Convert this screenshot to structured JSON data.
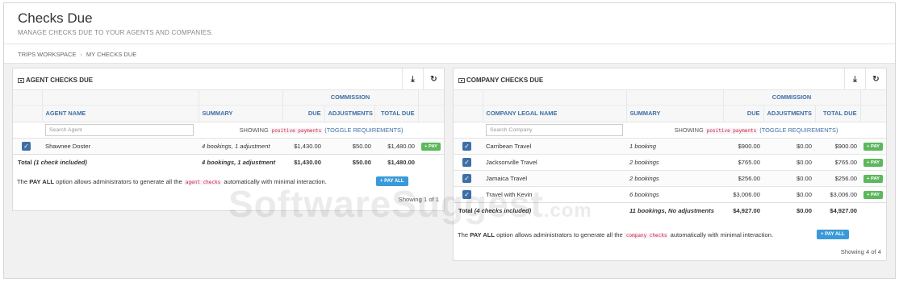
{
  "page": {
    "title": "Checks Due",
    "subtitle": "MANAGE CHECKS DUE TO YOUR AGENTS AND COMPANIES."
  },
  "breadcrumb": [
    "TRIPS WORKSPACE",
    "MY CHECKS DUE"
  ],
  "agent_panel": {
    "title": "AGENT CHECKS DUE",
    "group_header": "COMMISSION",
    "columns": [
      "AGENT NAME",
      "SUMMARY",
      "DUE",
      "ADJUSTMENTS",
      "TOTAL DUE"
    ],
    "search_placeholder": "Search Agent",
    "showing_prefix": "SHOWING",
    "showing_code": "positive payments",
    "showing_toggle": "(TOGGLE REQUIREMENTS)",
    "rows": [
      {
        "name": "Shawnee Doster",
        "summary": "4 bookings, 1 adjustment",
        "due": "$1,430.00",
        "adjustments": "$50.00",
        "total": "$1,480.00",
        "pay": "+ PAY"
      }
    ],
    "total": {
      "label": "Total",
      "label_detail": "(1 check included)",
      "summary": "4 bookings, 1 adjustment",
      "due": "$1,430.00",
      "adjustments": "$50.00",
      "total": "$1,480.00"
    },
    "note_pre": "The",
    "note_bold": "PAY ALL",
    "note_mid": "option allows administrators to generate all the",
    "note_code": "agent checks",
    "note_post": "automatically with minimal interaction.",
    "pay_all": "+ PAY ALL",
    "showing_count": "Showing 1 of 1"
  },
  "company_panel": {
    "title": "COMPANY CHECKS DUE",
    "group_header": "COMMISSION",
    "columns": [
      "COMPANY LEGAL NAME",
      "SUMMARY",
      "DUE",
      "ADJUSTMENTS",
      "TOTAL DUE"
    ],
    "search_placeholder": "Search Company",
    "showing_prefix": "SHOWING",
    "showing_code": "positive payments",
    "showing_toggle": "(TOGGLE REQUIREMENTS)",
    "rows": [
      {
        "name": "Carribean Travel",
        "summary": "1 booking",
        "due": "$900.00",
        "adjustments": "$0.00",
        "total": "$900.00",
        "pay": "+ PAY"
      },
      {
        "name": "Jacksonville Travel",
        "summary": "2 bookings",
        "due": "$765.00",
        "adjustments": "$0.00",
        "total": "$765.00",
        "pay": "+ PAY"
      },
      {
        "name": "Jamaica Travel",
        "summary": "2 bookings",
        "due": "$256.00",
        "adjustments": "$0.00",
        "total": "$256.00",
        "pay": "+ PAY"
      },
      {
        "name": "Travel with Kevin",
        "summary": "6 bookings",
        "due": "$3,006.00",
        "adjustments": "$0.00",
        "total": "$3,006.00",
        "pay": "+ PAY"
      }
    ],
    "total": {
      "label": "Total",
      "label_detail": "(4 checks included)",
      "summary": "11 bookings, No adjustments",
      "due": "$4,927.00",
      "adjustments": "$0.00",
      "total": "$4,927.00"
    },
    "note_pre": "The",
    "note_bold": "PAY ALL",
    "note_mid": "option allows administrators to generate all the",
    "note_code": "company checks",
    "note_post": "automatically with minimal interaction.",
    "pay_all": "+ PAY ALL",
    "showing_count": "Showing 4 of 4"
  },
  "watermark": {
    "text": "SoftwareSuggest",
    "suffix": ".com"
  },
  "colors": {
    "accent": "#3d6fa6",
    "pay_green": "#5cb85c",
    "pay_all_blue": "#3a9ad9"
  }
}
